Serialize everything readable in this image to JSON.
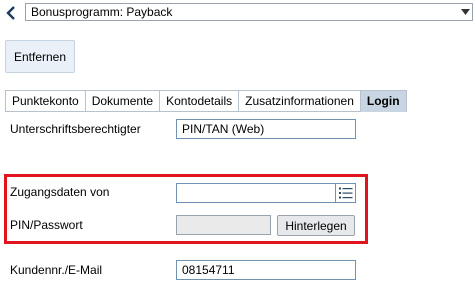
{
  "header": {
    "program_value": "Bonusprogramm: Payback"
  },
  "actions": {
    "remove_label": "Entfernen"
  },
  "tabs": [
    {
      "label": "Punktekonto",
      "active": false
    },
    {
      "label": "Dokumente",
      "active": false
    },
    {
      "label": "Kontodetails",
      "active": false
    },
    {
      "label": "Zusatzinformationen",
      "active": false
    },
    {
      "label": "Login",
      "active": true
    }
  ],
  "login": {
    "signatory_label": "Unterschriftsberechtigter",
    "signatory_value": "PIN/TAN (Web)",
    "access_label": "Zugangsdaten von",
    "access_value": "",
    "pin_label": "PIN/Passwort",
    "pin_value": "",
    "store_label": "Hinterlegen",
    "customer_label": "Kundennr./E-Mail",
    "customer_value": "08154711"
  },
  "colors": {
    "highlight": "#e0141f",
    "active_tab": "#c8d6e3",
    "button_bg": "#e9f0f8"
  }
}
